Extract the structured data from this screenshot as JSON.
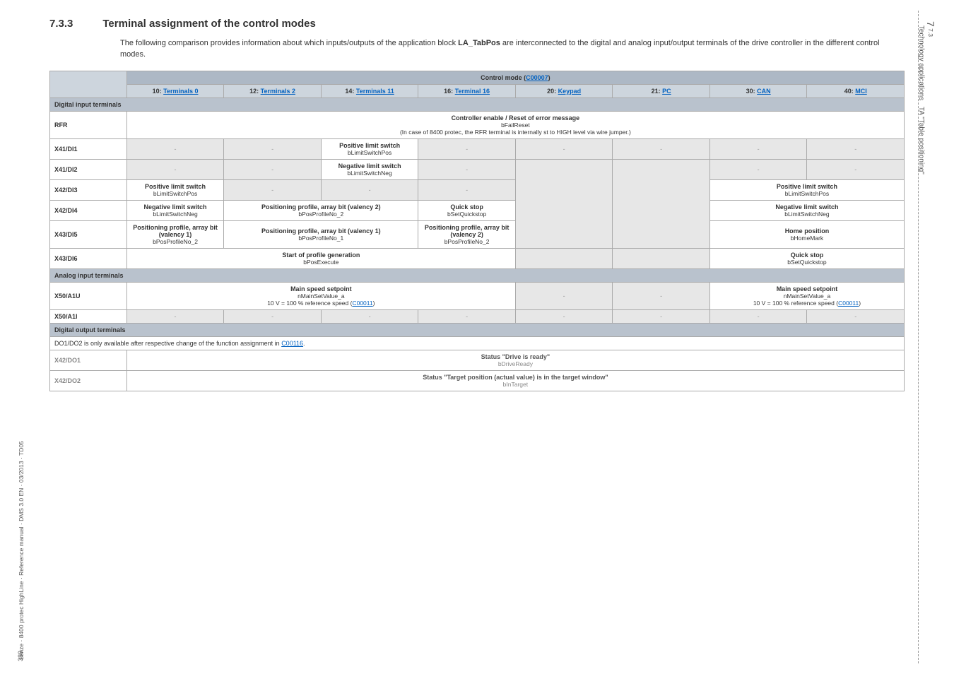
{
  "sidebar_left": "Lenze · 8400 protec HighLine · Reference manual · DMS 3.0 EN · 03/2013 · TD05",
  "page_number": "389",
  "chapter_num": "7",
  "chapter_sub": "7.3",
  "chapter_title": "Technology applications",
  "chapter_ta": "TA \"Table positioning\"",
  "section_num": "7.3.3",
  "section_title": "Terminal assignment of the control modes",
  "intro_a": "The following comparison provides information about which inputs/outputs of the application block ",
  "intro_b": "LA_TabPos",
  "intro_c": " are interconnected to the digital and analog input/output terminals of the drive controller in the different control modes.",
  "hdr_ctrlmode": "Control mode (",
  "hdr_ctrlmode_code": "C00007",
  "hdr_ctrlmode_close": ")",
  "cols": {
    "c1": "10:",
    "c1_link": "Terminals 0",
    "c2": "12:",
    "c2_link": "Terminals 2",
    "c3": "14:",
    "c3_link": "Terminals 11",
    "c4": "16:",
    "c4_link": "Terminal 16",
    "c5": "20:",
    "c5_link": "Keypad",
    "c6": "21:",
    "c6_link": "PC",
    "c7": "30:",
    "c7_link": "CAN",
    "c8": "40:",
    "c8_link": "MCI"
  },
  "sect_din": "Digital input terminals",
  "rfr": {
    "label": "RFR",
    "line1": "Controller enable / Reset of error message",
    "sub": "bFailReset",
    "line2": "(In case of 8400 protec, the RFR terminal is internally st to HIGH level via wire jumper.)"
  },
  "di1": {
    "label": "X41/DI1",
    "txt": "Positive limit switch",
    "sub": "bLimitSwitchPos"
  },
  "di2": {
    "label": "X41/DI2",
    "txt": "Negative limit switch",
    "sub": "bLimitSwitchNeg"
  },
  "di3": {
    "label": "X42/DI3",
    "a_txt": "Positive limit switch",
    "a_sub": "bLimitSwitchPos",
    "r_txt": "Positive limit switch",
    "r_sub": "bLimitSwitchPos"
  },
  "di4": {
    "label": "X42/DI4",
    "a_txt": "Negative limit switch",
    "a_sub": "bLimitSwitchNeg",
    "b_txt": "Positioning profile, array bit (valency 2)",
    "b_sub": "bPosProfileNo_2",
    "c_txt": "Quick stop",
    "c_sub": "bSetQuickstop",
    "r_txt": "Negative limit switch",
    "r_sub": "bLimitSwitchNeg"
  },
  "di5": {
    "label": "X43/DI5",
    "a_txt": "Positioning profile, array bit (valency 1)",
    "a_sub": "bPosProfileNo_2",
    "b_txt": "Positioning profile, array bit (valency 1)",
    "b_sub": "bPosProfileNo_1",
    "c_txt": "Positioning profile, array bit (valency 2)",
    "c_sub": "bPosProfileNo_2",
    "r_txt": "Home position",
    "r_sub": "bHomeMark"
  },
  "di6": {
    "label": "X43/DI6",
    "a_txt": "Start of profile generation",
    "a_sub": "bPosExecute",
    "r_txt": "Quick stop",
    "r_sub": "bSetQuickstop"
  },
  "sect_ain": "Analog input terminals",
  "a1u": {
    "label": "X50/A1U",
    "txt": "Main speed setpoint",
    "sub": "nMainSetValue_a",
    "line3a": "10 V = 100 % reference speed (",
    "line3_code": "C00011",
    "line3b": ")",
    "r_txt": "Main speed setpoint",
    "r_sub": "nMainSetValue_a",
    "r_line3a": "10 V = 100 % reference speed (",
    "r_line3b": ")"
  },
  "a1i": {
    "label": "X50/A1I"
  },
  "sect_dout": "Digital output terminals",
  "dout_note_a": "DO1/DO2 is only available after respective change of the function assignment in ",
  "dout_note_code": "C00116",
  "dout_note_b": ".",
  "do1": {
    "label": "X42/DO1",
    "txt": "Status \"Drive is ready\"",
    "sub": "bDriveReady"
  },
  "do2": {
    "label": "X42/DO2",
    "txt": "Status \"Target position (actual value) is in the target window\"",
    "sub": "bInTarget"
  },
  "dash": "-"
}
